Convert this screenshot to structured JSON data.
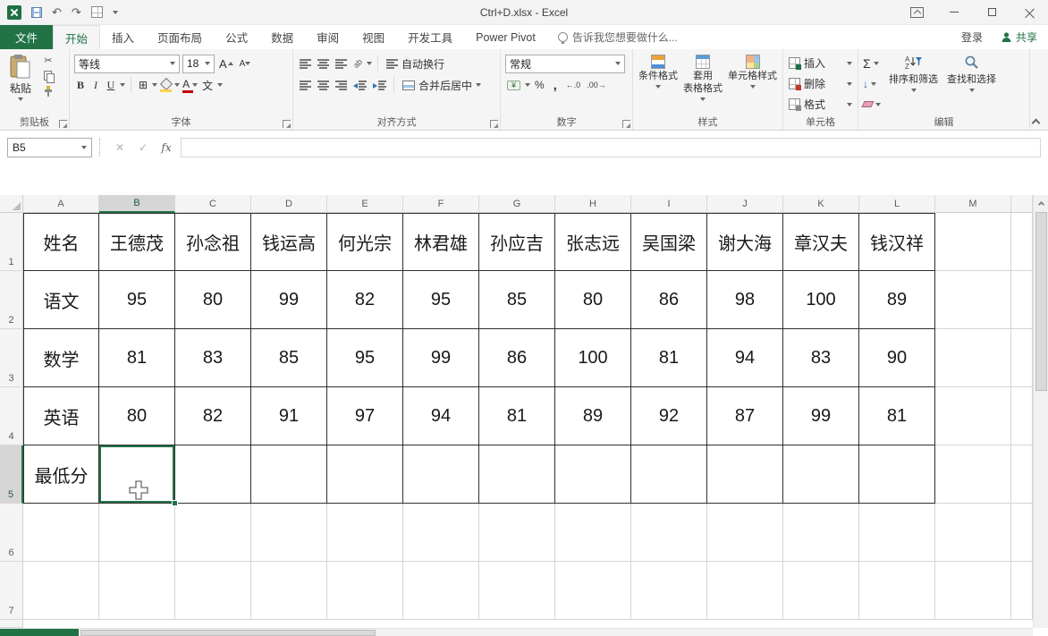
{
  "window": {
    "title": "Ctrl+D.xlsx - Excel"
  },
  "tabs": {
    "file": "文件",
    "items": [
      "开始",
      "插入",
      "页面布局",
      "公式",
      "数据",
      "审阅",
      "视图",
      "开发工具",
      "Power Pivot"
    ],
    "active": "开始",
    "tell_me": "告诉我您想要做什么...",
    "sign_in": "登录",
    "share": "共享"
  },
  "ribbon": {
    "clipboard": {
      "label": "剪贴板",
      "paste": "粘贴"
    },
    "font": {
      "label": "字体",
      "font_name": "等线",
      "font_size": "18",
      "bold": "B",
      "italic": "I",
      "underline": "U",
      "color_letter": "A",
      "phonetic": "文"
    },
    "alignment": {
      "label": "对齐方式",
      "wrap_text": "自动换行",
      "merge_center": "合并后居中",
      "orientation": "ab"
    },
    "number": {
      "label": "数字",
      "format": "常规",
      "currency": "¥",
      "percent": "%",
      "comma": ",",
      "inc_decimal": "←.0",
      "dec_decimal": ".00→"
    },
    "styles": {
      "label": "样式",
      "conditional": "条件格式",
      "format_table": "套用\n表格格式",
      "cell_styles": "单元格样式"
    },
    "cells": {
      "label": "单元格",
      "insert": "插入",
      "delete": "删除",
      "format": "格式"
    },
    "editing": {
      "label": "编辑",
      "autosum": "Σ",
      "sort_filter": "排序和筛选",
      "find_select": "查找和选择"
    }
  },
  "formula_bar": {
    "name_box": "B5",
    "value": ""
  },
  "icons": {
    "cut": "✂",
    "undo": "↶",
    "redo": "↷",
    "cancel": "✕",
    "check": "✓",
    "fx": "fx",
    "borders": "⊞",
    "fill_down": "↓"
  },
  "sheet": {
    "columns": [
      "A",
      "B",
      "C",
      "D",
      "E",
      "F",
      "G",
      "H",
      "I",
      "J",
      "K",
      "L",
      "M"
    ],
    "rows": [
      "1",
      "2",
      "3",
      "4",
      "5",
      "6",
      "7"
    ],
    "selected": {
      "cell": "B5",
      "col": "B",
      "row": "5"
    },
    "table": {
      "rows": [
        [
          "姓名",
          "王德茂",
          "孙念祖",
          "钱运高",
          "何光宗",
          "林君雄",
          "孙应吉",
          "张志远",
          "吴国梁",
          "谢大海",
          "章汉夫",
          "钱汉祥"
        ],
        [
          "语文",
          "95",
          "80",
          "99",
          "82",
          "95",
          "85",
          "80",
          "86",
          "98",
          "100",
          "89"
        ],
        [
          "数学",
          "81",
          "83",
          "85",
          "95",
          "99",
          "86",
          "100",
          "81",
          "94",
          "83",
          "90"
        ],
        [
          "英语",
          "80",
          "82",
          "91",
          "97",
          "94",
          "81",
          "89",
          "92",
          "87",
          "99",
          "81"
        ],
        [
          "最低分",
          "",
          "",
          "",
          "",
          "",
          "",
          "",
          "",
          "",
          "",
          ""
        ]
      ]
    }
  },
  "colors": {
    "excel_green": "#217346",
    "selection_border": "#217346"
  }
}
